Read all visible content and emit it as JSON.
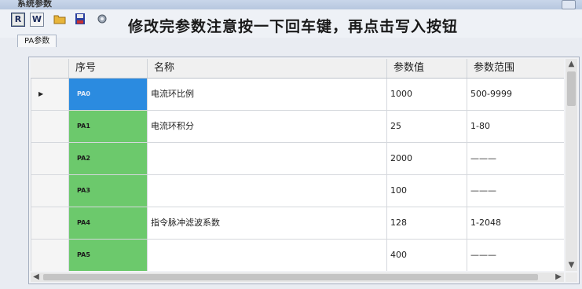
{
  "window": {
    "title": "系统参数"
  },
  "toolbar": {
    "read_label": "R",
    "write_label": "W",
    "notice": "修改完参数注意按一下回车键，再点击写入按钮"
  },
  "tab": {
    "label": "PA参数"
  },
  "table": {
    "headers": [
      "序号",
      "名称",
      "参数值",
      "参数范围"
    ],
    "rows": [
      {
        "id": "PA0",
        "name": "电流环比例",
        "value": "1000",
        "range": "500-9999"
      },
      {
        "id": "PA1",
        "name": "电流环积分",
        "value": "25",
        "range": "1-80"
      },
      {
        "id": "PA2",
        "name": "",
        "value": "2000",
        "range": "———"
      },
      {
        "id": "PA3",
        "name": "",
        "value": "100",
        "range": "———"
      },
      {
        "id": "PA4",
        "name": "指令脉冲滤波系数",
        "value": "128",
        "range": "1-2048"
      },
      {
        "id": "PA5",
        "name": "",
        "value": "400",
        "range": "———"
      }
    ],
    "selected_row": 0
  },
  "colors": {
    "id_cell": "#6cc96c",
    "selected": "#2b8be0"
  },
  "icons": [
    "read-icon",
    "write-icon",
    "open-folder-icon",
    "save-disk-icon",
    "settings-icon"
  ]
}
